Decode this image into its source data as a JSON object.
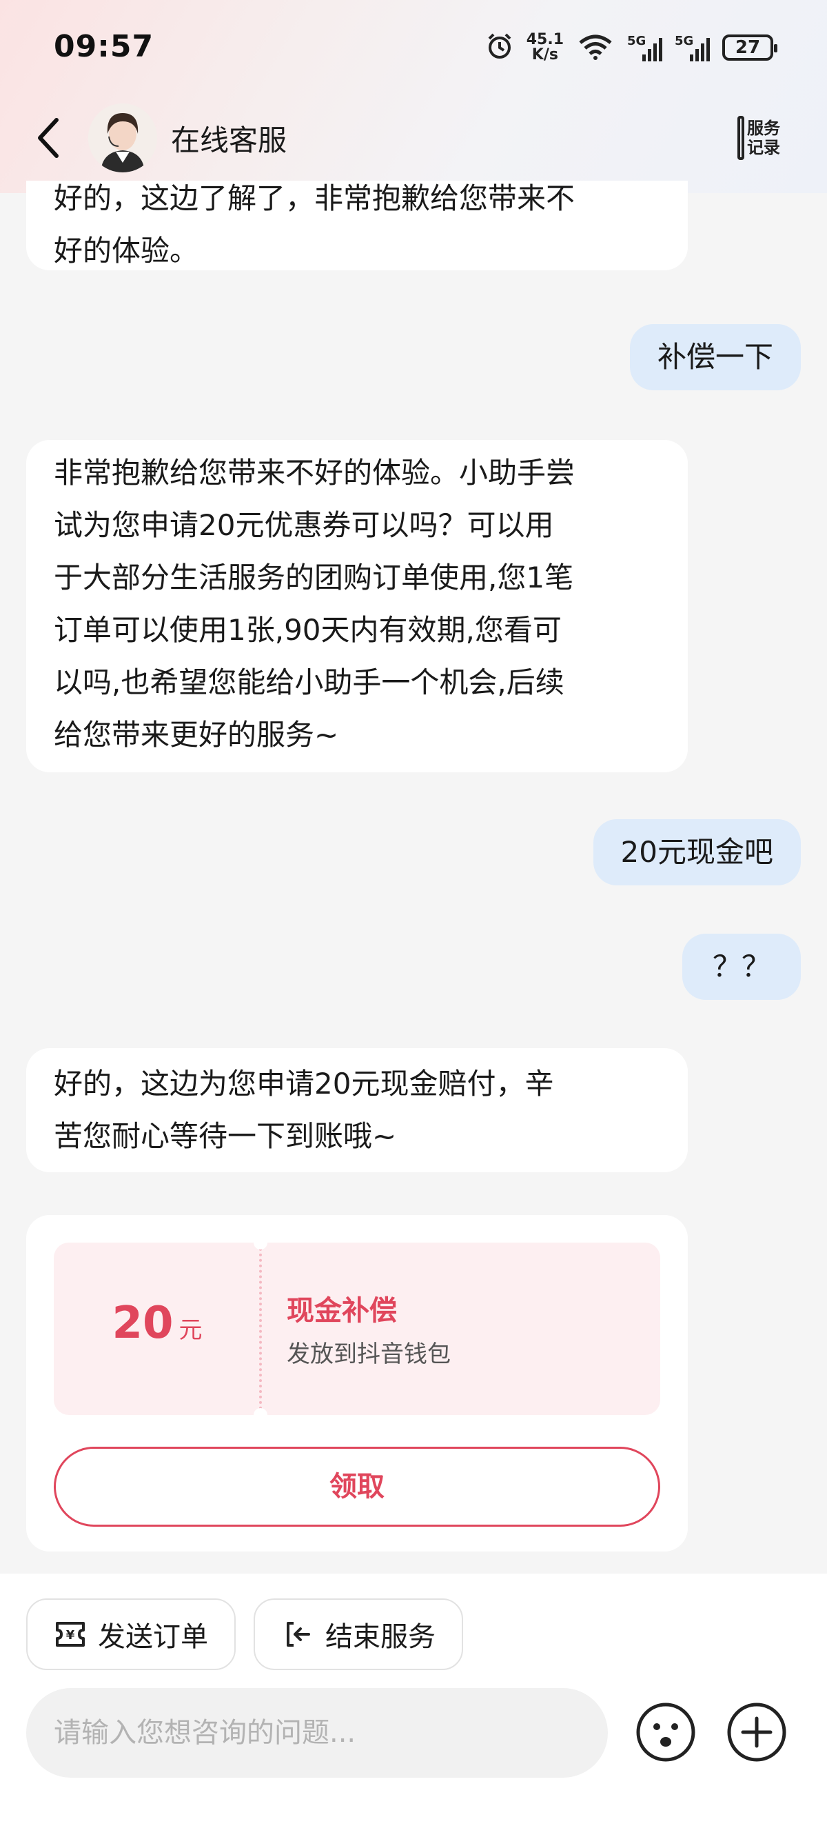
{
  "status_bar": {
    "time": "09:57",
    "net_speed_value": "45.1",
    "net_speed_unit": "K/s",
    "signal1_label": "5G",
    "signal2_label": "5G",
    "battery": "27"
  },
  "header": {
    "title": "在线客服",
    "service_log_line1": "服务",
    "service_log_line2": "记录"
  },
  "messages": [
    {
      "role": "agent",
      "text": "好的，这边了解了，非常抱歉给您带来不\n好的体验。"
    },
    {
      "role": "user",
      "text": "补偿一下"
    },
    {
      "role": "agent",
      "text": "非常抱歉给您带来不好的体验。小助手尝\n试为您申请20元优惠券可以吗？可以用\n于大部分生活服务的团购订单使用,您1笔\n订单可以使用1张,90天内有效期,您看可\n以吗,也希望您能给小助手一个机会,后续\n给您带来更好的服务~"
    },
    {
      "role": "user",
      "text": "20元现金吧"
    },
    {
      "role": "user",
      "text": "？？"
    },
    {
      "role": "agent",
      "text": "好的，这边为您申请20元现金赔付，辛\n苦您耐心等待一下到账哦~"
    }
  ],
  "coupon_card": {
    "amount": "20",
    "unit": "元",
    "title": "现金补偿",
    "description": "发放到抖音钱包",
    "claim_label": "领取"
  },
  "bottom_bar": {
    "send_order_label": "发送订单",
    "end_service_label": "结束服务",
    "input_placeholder": "请输入您想咨询的问题..."
  },
  "colors": {
    "accent": "#e0465c",
    "user_bubble": "#deebfa",
    "agent_bubble": "#ffffff",
    "background": "#f5f5f5"
  },
  "icons": [
    "alarm-icon",
    "wifi-icon",
    "signal-icon",
    "battery-icon",
    "back-arrow-icon",
    "service-record-icon",
    "order-icon",
    "exit-icon",
    "emoji-icon",
    "plus-icon"
  ]
}
